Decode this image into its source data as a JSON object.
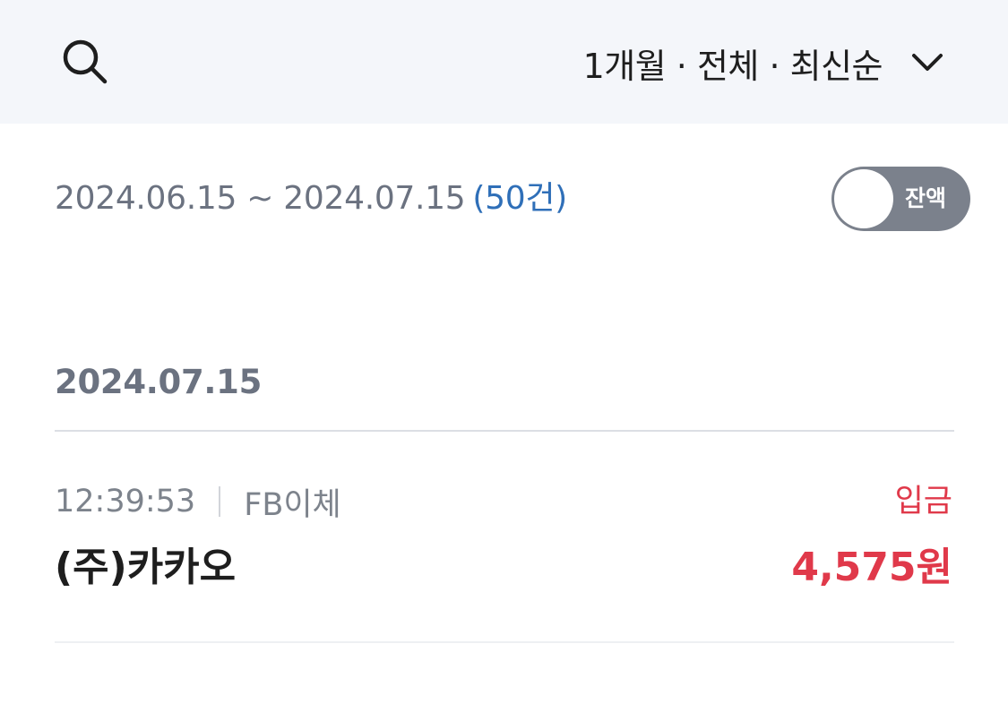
{
  "header": {
    "search_icon": "search-icon",
    "filter_label": "1개월 · 전체 · 최신순",
    "filter_icon": "chevron-down-icon"
  },
  "summary": {
    "date_range": "2024.06.15 ~ 2024.07.15",
    "count": "(50건)",
    "balance_toggle": {
      "label": "잔액",
      "on": false
    }
  },
  "groups": [
    {
      "date": "2024.07.15",
      "transactions": [
        {
          "time": "12:39:53",
          "method": "FB이체",
          "type": "입금",
          "name": "(주)카카오",
          "amount": "4,575원"
        }
      ]
    }
  ],
  "colors": {
    "header_bg": "#f4f6fa",
    "muted_text": "#6b7280",
    "count_blue": "#2f6fb8",
    "deposit_red": "#e0394a",
    "toggle_bg": "#7b818c"
  }
}
